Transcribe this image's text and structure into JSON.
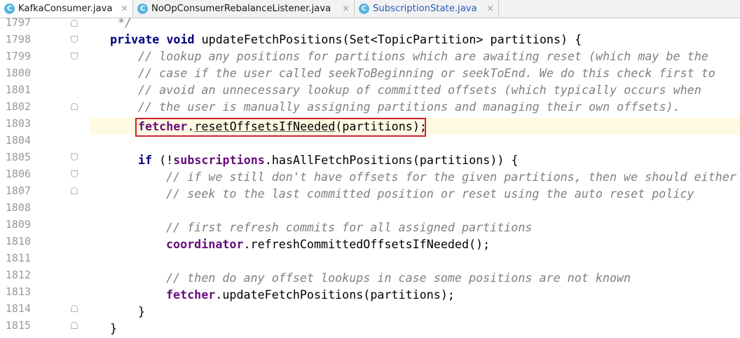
{
  "tabs": [
    {
      "label": "KafkaConsumer.java",
      "icon": "c-class-icon",
      "active": true
    },
    {
      "label": "NoOpConsumerRebalanceListener.java",
      "icon": "c-class-icon",
      "active": false
    },
    {
      "label": "SubscriptionState.java",
      "icon": "c-class-icon",
      "active": false
    }
  ],
  "close_glyph": "×",
  "class_glyph": "C",
  "line_numbers": [
    "1797",
    "1798",
    "1799",
    "1800",
    "1801",
    "1802",
    "1803",
    "1804",
    "1805",
    "1806",
    "1807",
    "1808",
    "1809",
    "1810",
    "1811",
    "1812",
    "1813",
    "1814",
    "1815"
  ],
  "code": {
    "l1797": "*/",
    "l1798_kw1": "private",
    "l1798_kw2": "void",
    "l1798_rest": " updateFetchPositions(Set<TopicPartition> partitions) {",
    "l1799": "// lookup any positions for partitions which are awaiting reset (which may be the",
    "l1800": "// case if the user called seekToBeginning or seekToEnd. We do this check first to",
    "l1801": "// avoid an unnecessary lookup of committed offsets (which typically occurs when",
    "l1802": "// the user is manually assigning partitions and managing their own offsets).",
    "l1803_fld": "fetcher",
    "l1803_dot": ".",
    "l1803_call": "resetOffsetsIfNeeded",
    "l1803_rest": "(partitions);",
    "l1805_kw": "if",
    "l1805_a": " (!",
    "l1805_fld": "subscriptions",
    "l1805_rest": ".hasAllFetchPositions(partitions)) {",
    "l1806": "// if we still don't have offsets for the given partitions, then we should either",
    "l1807": "// seek to the last committed position or reset using the auto reset policy",
    "l1809": "// first refresh commits for all assigned partitions",
    "l1810_fld": "coordinator",
    "l1810_rest": ".refreshCommittedOffsetsIfNeeded();",
    "l1812": "// then do any offset lookups in case some positions are not known",
    "l1813_fld": "fetcher",
    "l1813_rest": ".updateFetchPositions(partitions);",
    "l1814": "}",
    "l1815": "}"
  },
  "colors": {
    "keyword": "#000080",
    "comment": "#808080",
    "field": "#660e7a",
    "caret_row": "#fffae3",
    "highlight_box": "#d01f27",
    "class_icon": "#56b4e0"
  }
}
